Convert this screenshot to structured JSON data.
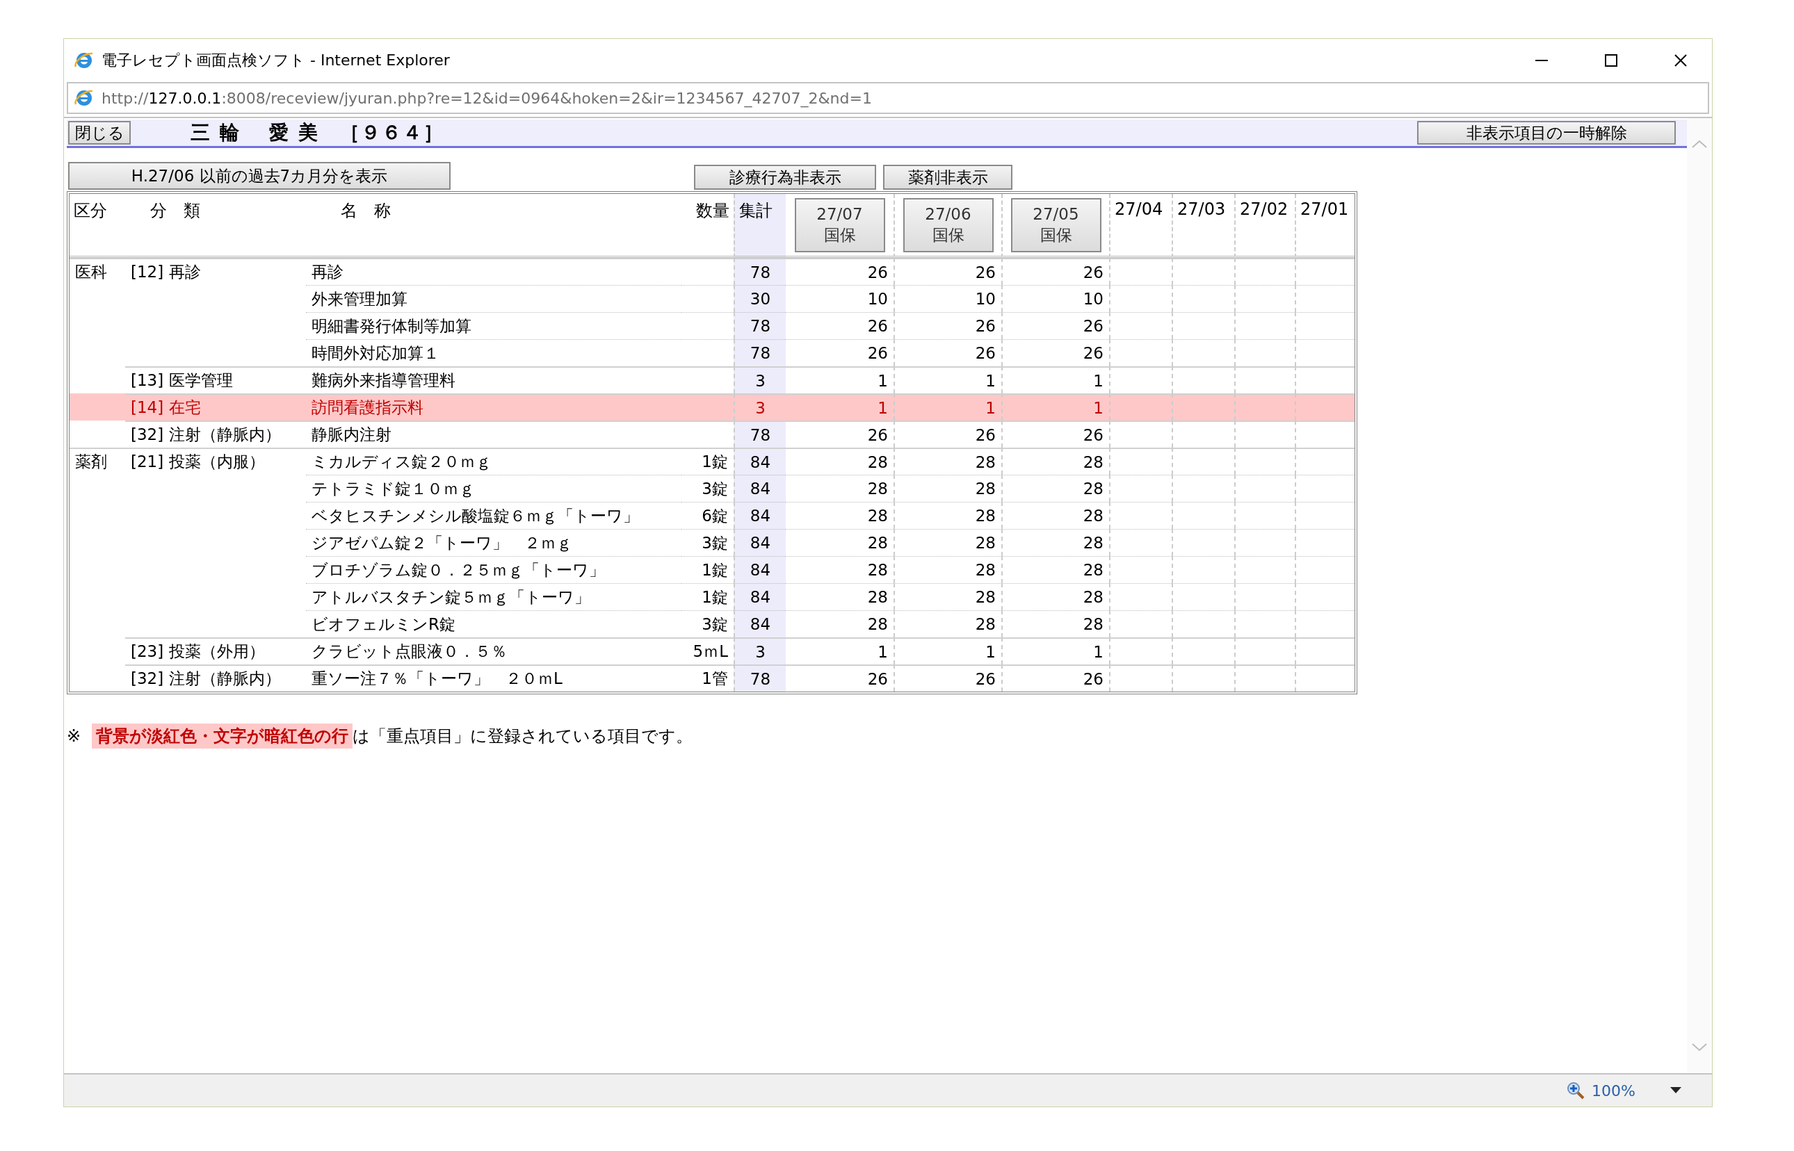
{
  "window": {
    "title": "電子レセプト画面点検ソフト - Internet Explorer"
  },
  "address_bar": {
    "url_prefix": "http://",
    "url_host": "127.0.0.1",
    "url_rest": ":8008/receview/jyuran.php?re=12&id=0964&hoken=2&ir=1234567_42707_2&nd=1"
  },
  "header": {
    "close_button": "閉じる",
    "patient": "三 輪　 愛 美　［９６４］",
    "unhide_button": "非表示項目の一時解除"
  },
  "toolbar": {
    "past_button": "H.27/06 以前の過去7カ月分を表示",
    "hide_treatment_button": "診療行為非表示",
    "hide_drug_button": "薬剤非表示"
  },
  "table": {
    "columns": {
      "kubun": "区分",
      "category": "分　類",
      "name": "名　称",
      "qty": "数量",
      "total": "集計"
    },
    "months": [
      {
        "label": "27/07",
        "insurer": "国保"
      },
      {
        "label": "27/06",
        "insurer": "国保"
      },
      {
        "label": "27/05",
        "insurer": "国保"
      },
      {
        "label": "27/04"
      },
      {
        "label": "27/03"
      },
      {
        "label": "27/02"
      },
      {
        "label": "27/01"
      }
    ],
    "rows": [
      {
        "kubun": "医科",
        "category": "[12] 再診",
        "name": "再診",
        "total": "78",
        "values": [
          "26",
          "26",
          "26"
        ],
        "highlighted": false
      },
      {
        "name": "外来管理加算",
        "total": "30",
        "values": [
          "10",
          "10",
          "10"
        ],
        "highlighted": false
      },
      {
        "name": "明細書発行体制等加算",
        "total": "78",
        "values": [
          "26",
          "26",
          "26"
        ],
        "highlighted": false
      },
      {
        "name": "時間外対応加算１",
        "total": "78",
        "values": [
          "26",
          "26",
          "26"
        ],
        "highlighted": false
      },
      {
        "category": "[13] 医学管理",
        "name": "難病外来指導管理料",
        "total": "3",
        "values": [
          "1",
          "1",
          "1"
        ],
        "highlighted": false
      },
      {
        "category": "[14] 在宅",
        "name": "訪問看護指示料",
        "total": "3",
        "values": [
          "1",
          "1",
          "1"
        ],
        "highlighted": true
      },
      {
        "category": "[32] 注射（静脈内）",
        "name": "静脈内注射",
        "total": "78",
        "values": [
          "26",
          "26",
          "26"
        ],
        "highlighted": false
      },
      {
        "kubun": "薬剤",
        "category": "[21] 投薬（内服）",
        "name": "ミカルディス錠２０ｍｇ",
        "qty": "1錠",
        "total": "84",
        "values": [
          "28",
          "28",
          "28"
        ],
        "highlighted": false
      },
      {
        "name": "テトラミド錠１０ｍｇ",
        "qty": "3錠",
        "total": "84",
        "values": [
          "28",
          "28",
          "28"
        ],
        "highlighted": false
      },
      {
        "name": "ベタヒスチンメシル酸塩錠６ｍｇ「トーワ」",
        "qty": "6錠",
        "total": "84",
        "values": [
          "28",
          "28",
          "28"
        ],
        "highlighted": false
      },
      {
        "name": "ジアゼパム錠２「トーワ」　２ｍｇ",
        "qty": "3錠",
        "total": "84",
        "values": [
          "28",
          "28",
          "28"
        ],
        "highlighted": false
      },
      {
        "name": "ブロチゾラム錠０．２５ｍｇ「トーワ」",
        "qty": "1錠",
        "total": "84",
        "values": [
          "28",
          "28",
          "28"
        ],
        "highlighted": false
      },
      {
        "name": "アトルバスタチン錠５ｍｇ「トーワ」",
        "qty": "1錠",
        "total": "84",
        "values": [
          "28",
          "28",
          "28"
        ],
        "highlighted": false
      },
      {
        "name": "ビオフェルミンR錠",
        "qty": "3錠",
        "total": "84",
        "values": [
          "28",
          "28",
          "28"
        ],
        "highlighted": false
      },
      {
        "category": "[23] 投薬（外用）",
        "name": "クラビット点眼液０．５％",
        "qty": "5ｍL",
        "total": "3",
        "values": [
          "1",
          "1",
          "1"
        ],
        "highlighted": false
      },
      {
        "category": "[32] 注射（静脈内）",
        "name": "重ソー注７％「トーワ」　２０ｍL",
        "qty": "1管",
        "total": "78",
        "values": [
          "26",
          "26",
          "26"
        ],
        "highlighted": false
      }
    ]
  },
  "note": {
    "mark": "※",
    "legend": "背景が淡紅色・文字が暗紅色の行",
    "text": "は「重点項目」に登録されている項目です。"
  },
  "status_bar": {
    "zoom": "100%"
  }
}
